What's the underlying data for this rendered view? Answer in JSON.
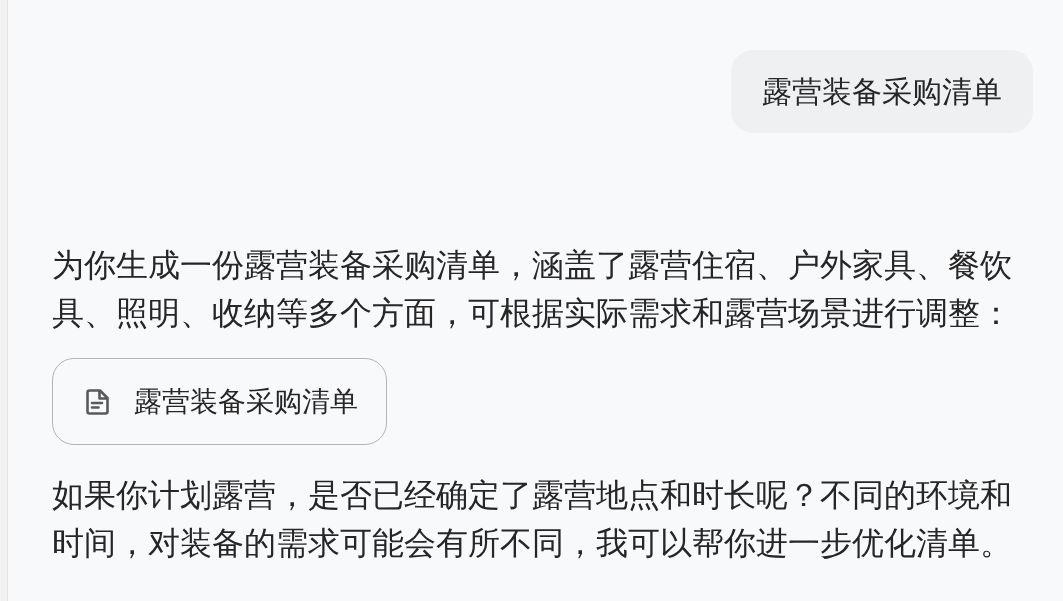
{
  "user_message": {
    "text": "露营装备采购清单"
  },
  "reply": {
    "intro": "为你生成一份露营装备采购清单，涵盖了露营住宿、户外家具、餐饮具、照明、收纳等多个方面，可根据实际需求和露营场景进行调整：",
    "attachment": {
      "title": "露营装备采购清单"
    },
    "follow_up": "如果你计划露营，是否已经确定了露营地点和时长呢？不同的环境和时间，对装备的需求可能会有所不同，我可以帮你进一步优化清单。"
  }
}
